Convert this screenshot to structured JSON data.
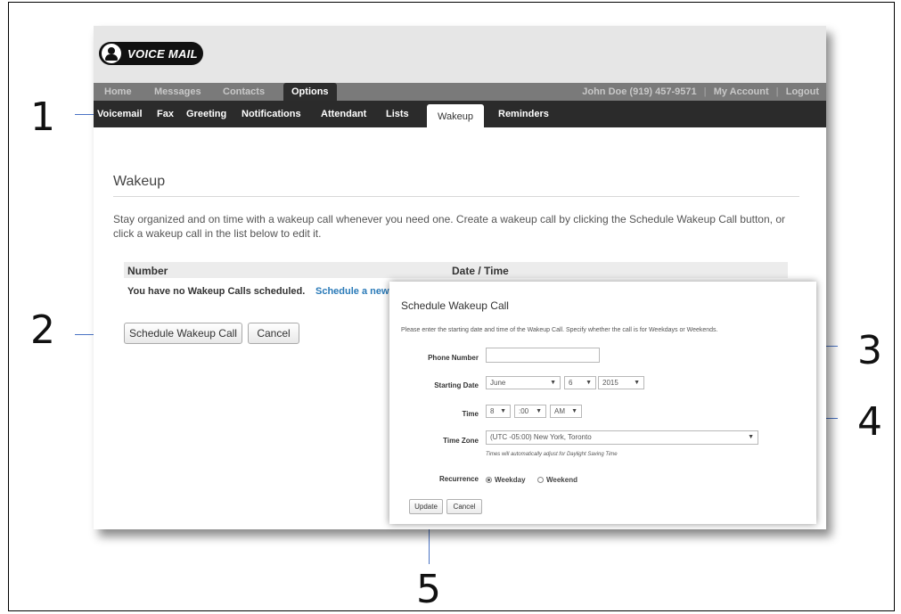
{
  "callouts": [
    "1",
    "2",
    "3",
    "4",
    "5"
  ],
  "app": {
    "logo_text": "VOICE MAIL"
  },
  "nav_top": {
    "tabs": [
      "Home",
      "Messages",
      "Contacts",
      "Options"
    ],
    "active": "Options",
    "account_info": "John Doe  (919) 457-9571",
    "my_account": "My Account",
    "logout": "Logout"
  },
  "nav_sub": {
    "tabs": [
      "Voicemail",
      "Fax",
      "Greeting",
      "Notifications",
      "Attendant",
      "Lists",
      "Wakeup",
      "Reminders"
    ],
    "active": "Wakeup"
  },
  "page": {
    "title": "Wakeup",
    "intro": "Stay organized and on time with a wakeup call whenever you need one. Create a wakeup call by clicking the Schedule Wakeup Call button, or click a wakeup call in the list below to edit it.",
    "table_headers": [
      "Number",
      "Date / Time"
    ],
    "empty_message": "You have no Wakeup Calls scheduled.",
    "schedule_link": "Schedule a new",
    "schedule_button": "Schedule Wakeup Call",
    "cancel_button": "Cancel"
  },
  "dialog": {
    "title": "Schedule Wakeup Call",
    "instructions": "Please enter the starting date and time of the Wakeup Call. Specify whether the call is for Weekdays or Weekends.",
    "phone_label": "Phone Number",
    "phone_value": "",
    "date_label": "Starting Date",
    "month": "June",
    "day": "6",
    "year": "2015",
    "time_label": "Time",
    "hour": "8",
    "minute": ":00",
    "ampm": "AM",
    "timezone_label": "Time Zone",
    "timezone": "(UTC -05:00) New York, Toronto",
    "timezone_hint": "Times will automatically adjust for Daylight Saving Time",
    "recurrence_label": "Recurrence",
    "recurrence_options": [
      "Weekday",
      "Weekend"
    ],
    "recurrence_selected": "Weekday",
    "update_button": "Update",
    "cancel_button": "Cancel"
  },
  "colors": {
    "link": "#2a7ab8",
    "callout_line": "#4a73c4",
    "nav_dark": "#2b2b2b",
    "nav_gray": "#7a7a7a"
  },
  "icons": {
    "logo": "person-icon",
    "select": "chevron-down-icon"
  }
}
